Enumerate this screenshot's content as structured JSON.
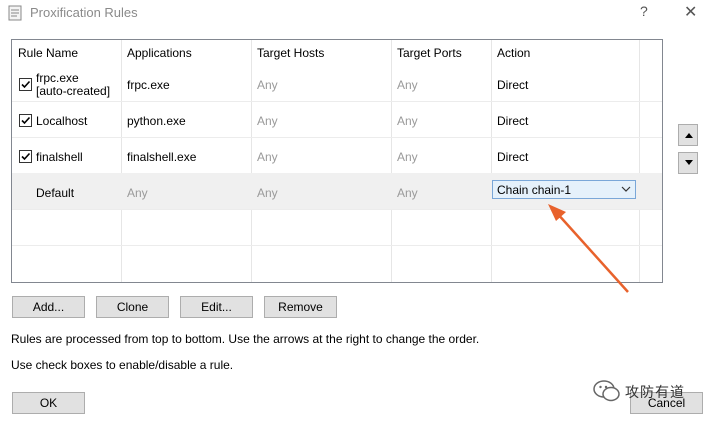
{
  "window": {
    "title": "Proxification Rules",
    "help_label": "?",
    "close_label": "✕"
  },
  "table": {
    "columns": [
      "Rule Name",
      "Applications",
      "Target Hosts",
      "Target Ports",
      "Action"
    ],
    "rows": [
      {
        "checked": true,
        "name_line1": "frpc.exe",
        "name_line2": "[auto-created]",
        "applications": "frpc.exe",
        "target_hosts": "Any",
        "target_ports": "Any",
        "action": "Direct"
      },
      {
        "checked": true,
        "name": "Localhost",
        "applications": "python.exe",
        "target_hosts": "Any",
        "target_ports": "Any",
        "action": "Direct"
      },
      {
        "checked": true,
        "name": "finalshell",
        "applications": "finalshell.exe",
        "target_hosts": "Any",
        "target_ports": "Any",
        "action": "Direct"
      },
      {
        "name": "Default",
        "applications": "Any",
        "target_hosts": "Any",
        "target_ports": "Any",
        "action": "Chain chain-1"
      }
    ]
  },
  "buttons": {
    "add": "Add...",
    "clone": "Clone",
    "edit": "Edit...",
    "remove": "Remove",
    "ok": "OK",
    "cancel": "Cancel"
  },
  "notes": {
    "order": "Rules are processed from top to bottom. Use the arrows at the right to change the order.",
    "checkboxes": "Use check boxes to enable/disable a rule."
  },
  "watermark": {
    "text": "攻防有道"
  },
  "colors": {
    "annotation_arrow": "#e8622c",
    "selected_combo_bg": "#e5f1fb",
    "selected_combo_border": "#7aa7d8"
  }
}
